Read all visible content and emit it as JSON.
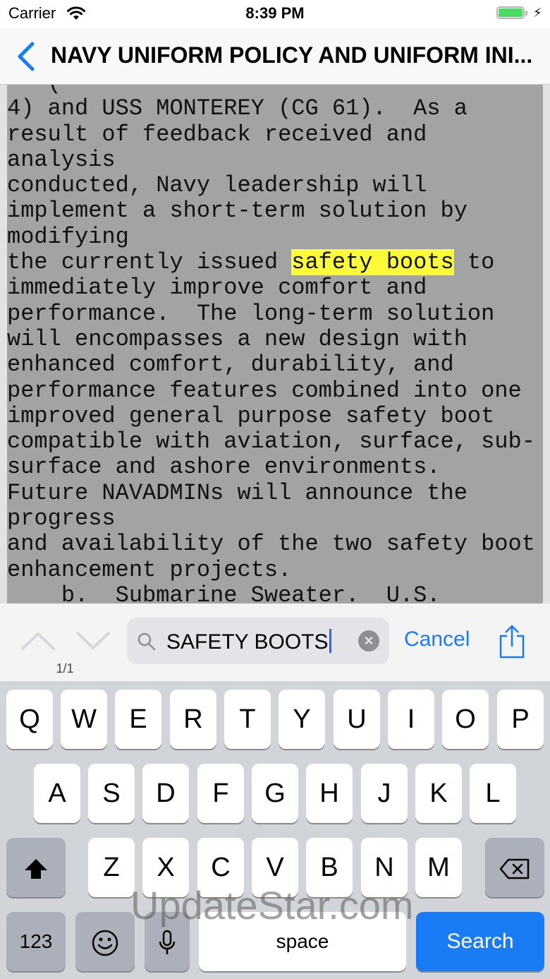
{
  "status_bar": {
    "carrier": "Carrier",
    "time": "8:39 PM"
  },
  "nav": {
    "title": "NAVY UNIFORM POLICY AND UNIFORM INI..."
  },
  "document": {
    "partial_top_line": "   (",
    "before_highlight": "4) and USS MONTEREY (CG 61).  As a\nresult of feedback received and\nanalysis\nconducted, Navy leadership will\nimplement a short-term solution by\nmodifying\nthe currently issued ",
    "highlight": "safety boots",
    "after_highlight": " to\nimmediately improve comfort and\nperformance.  The long-term solution\nwill encompasses a new design with\nenhanced comfort, durability, and\nperformance features combined into one\nimproved general purpose safety boot\ncompatible with aviation, surface, sub-\nsurface and ashore environments.\nFuture NAVADMINs will announce the\nprogress\nand availability of the two safety boot\nenhancement projects.\n    b.  Submarine Sweater.  U.S."
  },
  "find_bar": {
    "match_count": "1/1",
    "search_value": "SAFETY BOOTS",
    "cancel_label": "Cancel"
  },
  "keyboard": {
    "row1": [
      "Q",
      "W",
      "E",
      "R",
      "T",
      "Y",
      "U",
      "I",
      "O",
      "P"
    ],
    "row2": [
      "A",
      "S",
      "D",
      "F",
      "G",
      "H",
      "J",
      "K",
      "L"
    ],
    "row3": [
      "Z",
      "X",
      "C",
      "V",
      "B",
      "N",
      "M"
    ],
    "numbers_label": "123",
    "space_label": "space",
    "search_label": "Search"
  },
  "watermark": "UpdateStar.com",
  "colors": {
    "accent": "#1a7cf5",
    "highlight": "#fbfb3a",
    "doc_bg": "#a3a3a3",
    "battery": "#4cd964"
  },
  "icons": [
    "wifi-icon",
    "battery-icon",
    "back-chevron-icon",
    "previous-match-icon",
    "next-match-icon",
    "search-icon",
    "clear-icon",
    "share-icon",
    "shift-icon",
    "delete-icon",
    "emoji-icon",
    "microphone-icon"
  ]
}
